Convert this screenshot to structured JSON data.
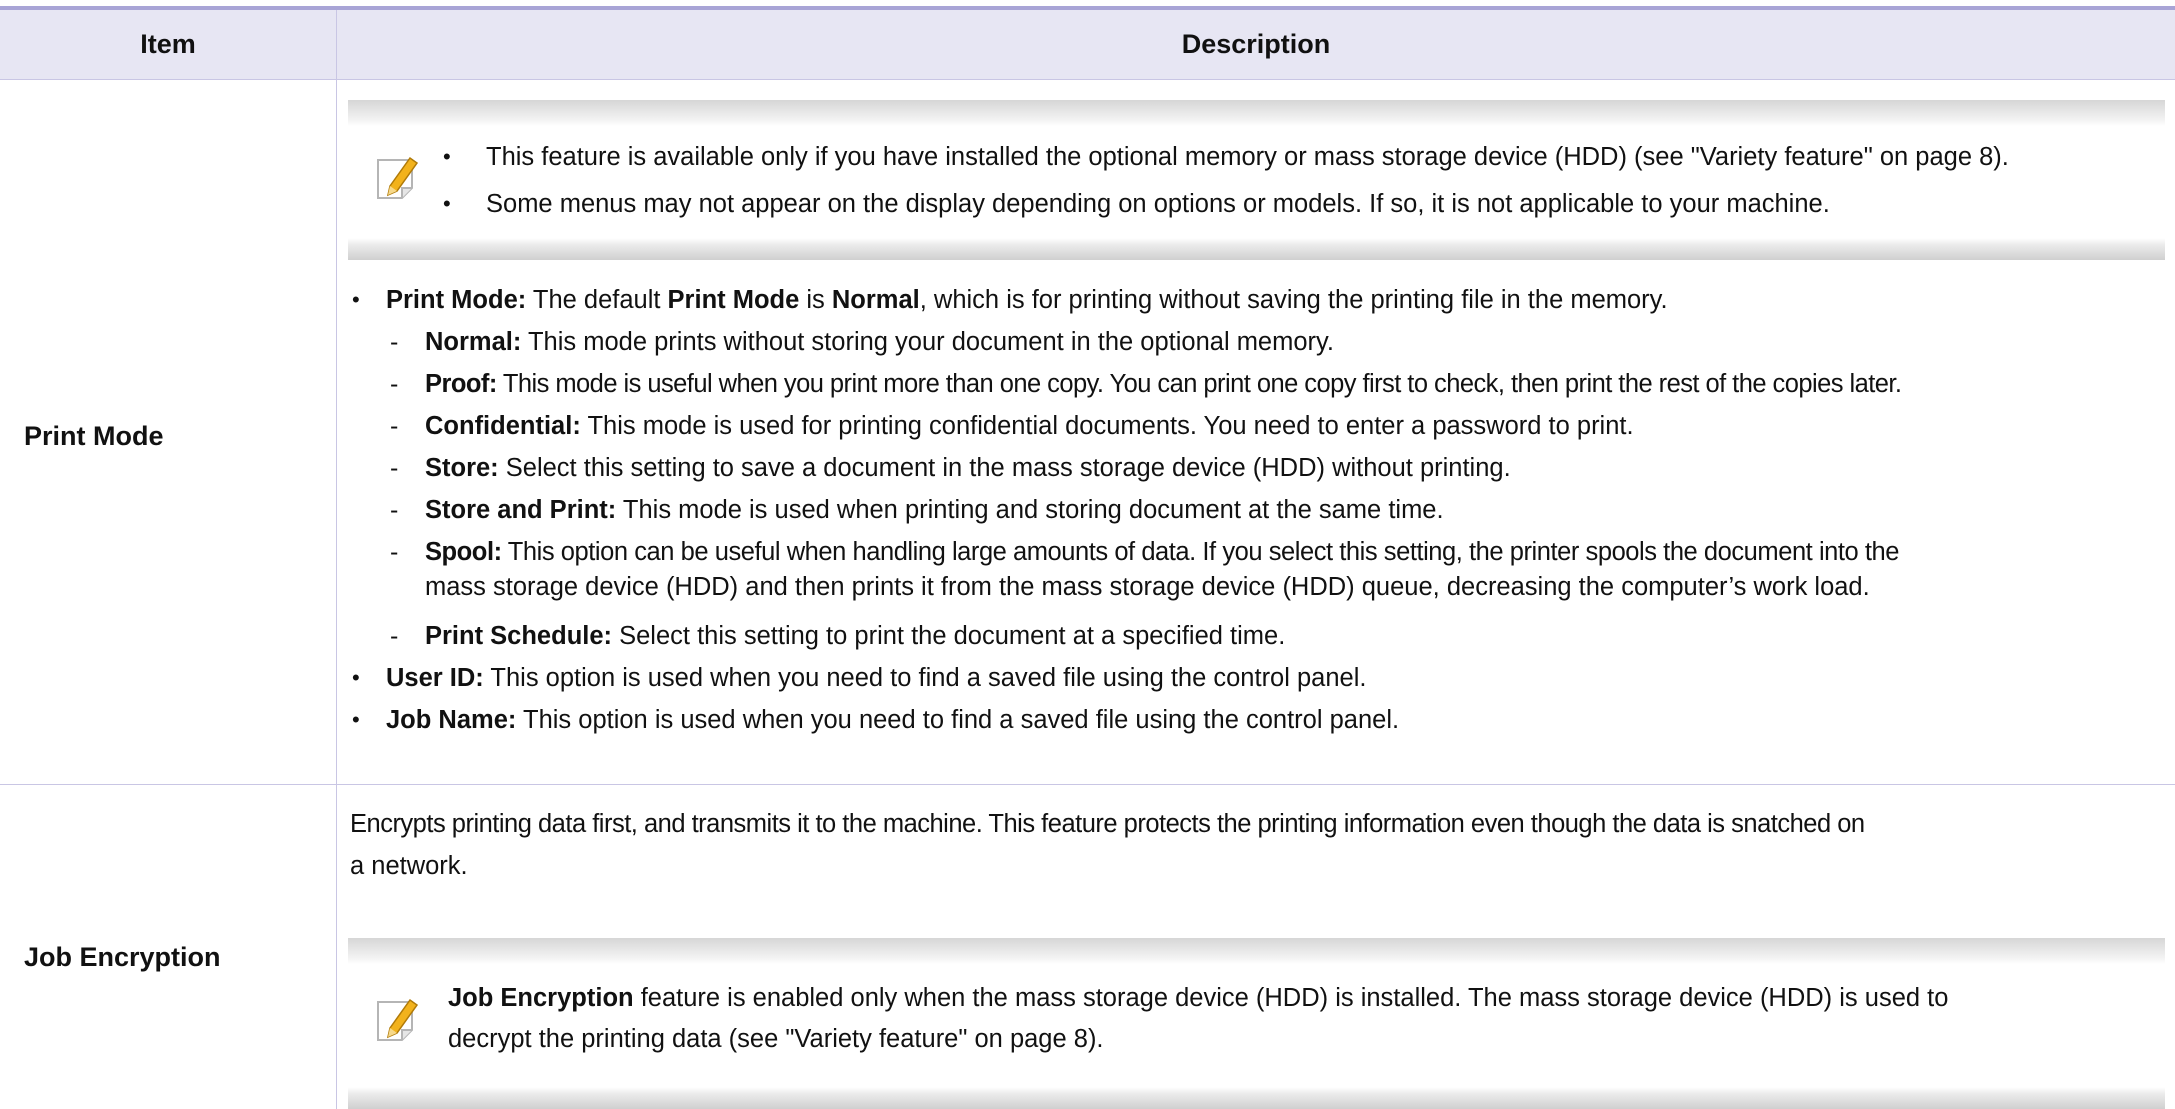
{
  "header": {
    "item": "Item",
    "description": "Description"
  },
  "rows": {
    "print_mode": {
      "label": "Print Mode",
      "note_bullets": [
        "This feature is available only if you have installed the optional memory or mass storage device (HDD) (see \"Variety feature\" on page 8).",
        "Some menus may not appear on the display depending on options or models. If so, it is not applicable to your machine."
      ],
      "intro": {
        "term": "Print Mode:",
        "t1": " The default ",
        "b1": "Print Mode",
        "t2": " is ",
        "b2": "Normal",
        "t3": ", which is for printing without saving the printing file in the memory."
      },
      "modes": [
        {
          "term": "Normal:",
          "text": " This mode prints without storing your document in the optional memory."
        },
        {
          "term": "Proof:",
          "text": " This mode is useful when you print more than one copy. You can print one copy first to check, then print the rest of the copies later."
        },
        {
          "term": "Confidential:",
          "text": " This mode is used for printing confidential documents. You need to enter a password to print."
        },
        {
          "term": "Store:",
          "text": " Select this setting to save a document in the mass storage device (HDD) without printing."
        },
        {
          "term": "Store and Print:",
          "text": " This mode is used when printing and storing document at the same time."
        },
        {
          "term": "Spool:",
          "text": " This option can be useful when handling large amounts of data. If you select this setting, the printer spools the document into the",
          "text2": "mass storage device (HDD) and then prints it from the mass storage device (HDD) queue, decreasing the computer’s work load."
        },
        {
          "term": "Print Schedule:",
          "text": " Select this setting to print the document at a specified time."
        }
      ],
      "extras": [
        {
          "term": "User ID:",
          "text": " This option is used when you need to find a saved file using the control panel."
        },
        {
          "term": "Job Name:",
          "text": " This option is used when you need to find a saved file using the control panel."
        }
      ]
    },
    "job_encryption": {
      "label": "Job Encryption",
      "desc_line1": "Encrypts printing data first, and transmits it to the machine. This feature protects the printing information even though the data is snatched on",
      "desc_line2": "a network.",
      "note_term": "Job Encryption",
      "note_line1": " feature is enabled only when the mass storage device (HDD) is installed. The mass storage device (HDD) is used to",
      "note_line2": "decrypt the printing data (see \"Variety feature\" on page 8)."
    }
  },
  "icons": {
    "note": "note-pencil-icon"
  },
  "colors": {
    "header_bg": "#e7e6f3",
    "rule": "#a8a4d6",
    "grid": "#c9c6e4",
    "pencil": "#f2b21c"
  }
}
